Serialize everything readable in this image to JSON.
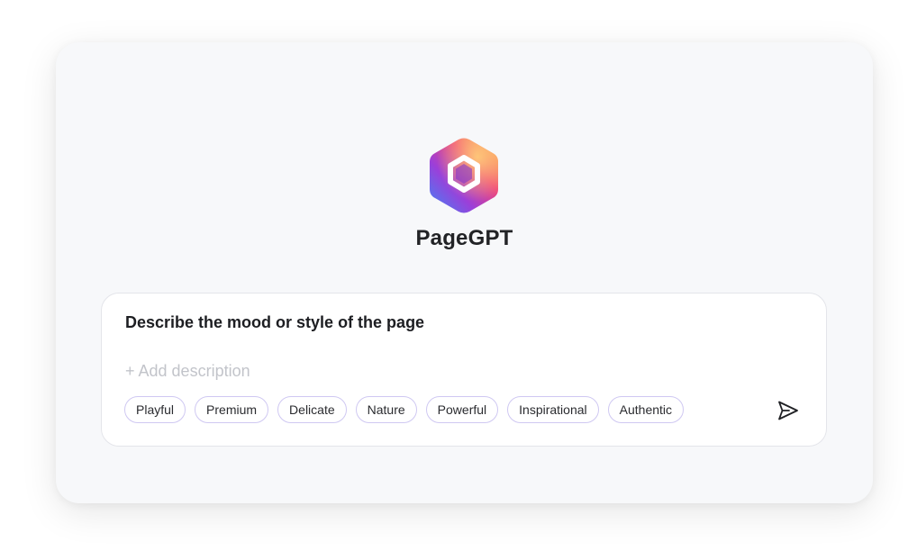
{
  "app": {
    "brand_name": "PageGPT",
    "logo_icon": "hexagon-logo-icon"
  },
  "prompt": {
    "title": "Describe the mood or style of the page",
    "description_placeholder": "+ Add description",
    "description_value": "",
    "send_icon": "send-icon"
  },
  "style_tags": [
    {
      "label": "Playful"
    },
    {
      "label": "Premium"
    },
    {
      "label": "Delicate"
    },
    {
      "label": "Nature"
    },
    {
      "label": "Powerful"
    },
    {
      "label": "Inspirational"
    },
    {
      "label": "Authentic"
    }
  ],
  "colors": {
    "card_background": "#f7f8fa",
    "chip_border": "#cfc8f2",
    "logo_gradient": [
      "#ff9a3c",
      "#e0306e",
      "#8a3bd8",
      "#3d7cf5"
    ]
  }
}
